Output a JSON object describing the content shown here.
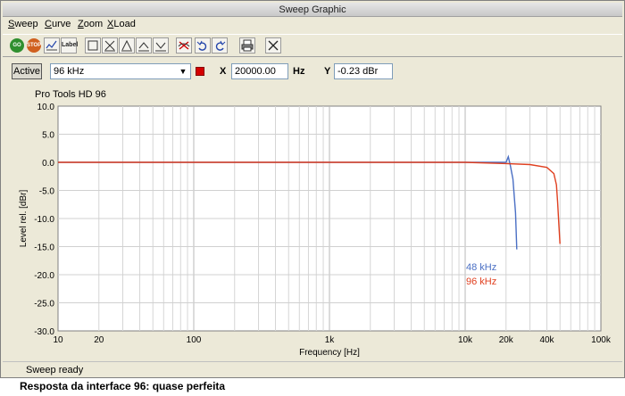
{
  "window": {
    "title": "Sweep Graphic"
  },
  "menu": [
    {
      "label": "Sweep"
    },
    {
      "label": "Curve"
    },
    {
      "label": "Zoom"
    },
    {
      "label": "XLoad"
    }
  ],
  "toolbar": {
    "go_label": "GO",
    "stop_label": "STOP",
    "label_label": "Label"
  },
  "options": {
    "active_label": "Active",
    "curve_selected": "96 kHz",
    "curve_color": "#d40000",
    "x_label": "X",
    "x_value": "20000.00",
    "x_unit": "Hz",
    "y_label": "Y",
    "y_value": "-0.23 dBr"
  },
  "status": {
    "text": "Sweep ready"
  },
  "caption": "Resposta da interface 96: quase perfeita",
  "chart_data": {
    "type": "line",
    "title": "Pro Tools HD 96",
    "xlabel": "Frequency [Hz]",
    "ylabel": "Level rel. [dBr]",
    "xscale": "log",
    "xlim": [
      10,
      100000
    ],
    "ylim": [
      -30,
      10
    ],
    "grid": true,
    "x_ticks": [
      {
        "value": 10,
        "label": "10"
      },
      {
        "value": 20,
        "label": "20"
      },
      {
        "value": 100,
        "label": "100"
      },
      {
        "value": 1000,
        "label": "1k"
      },
      {
        "value": 10000,
        "label": "10k"
      },
      {
        "value": 20000,
        "label": "20k"
      },
      {
        "value": 40000,
        "label": "40k"
      },
      {
        "value": 100000,
        "label": "100k"
      }
    ],
    "y_ticks": [
      {
        "value": 10,
        "label": "10.0"
      },
      {
        "value": 5,
        "label": "5.0"
      },
      {
        "value": 0,
        "label": "0.0"
      },
      {
        "value": -5,
        "label": "-5.0"
      },
      {
        "value": -10,
        "label": "-10.0"
      },
      {
        "value": -15,
        "label": "-15.0"
      },
      {
        "value": -20,
        "label": "-20.0"
      },
      {
        "value": -25,
        "label": "-25.0"
      },
      {
        "value": -30,
        "label": "-30.0"
      }
    ],
    "legend_placement": "center-right",
    "series": [
      {
        "name": "48 kHz",
        "color": "#4a6fc4",
        "x": [
          10,
          100,
          1000,
          10000,
          18000,
          20000,
          20800,
          21500,
          22500,
          23500,
          24000
        ],
        "y": [
          0,
          0,
          0,
          0,
          0,
          0,
          1.0,
          -0.5,
          -3,
          -9,
          -15.5
        ]
      },
      {
        "name": "96 kHz",
        "color": "#e04020",
        "x": [
          10,
          100,
          1000,
          10000,
          20000,
          30000,
          40000,
          45000,
          47000,
          48000,
          49000,
          50000
        ],
        "y": [
          0,
          0,
          0,
          0,
          -0.23,
          -0.4,
          -0.9,
          -2,
          -4,
          -7,
          -11,
          -14.5
        ]
      }
    ]
  }
}
